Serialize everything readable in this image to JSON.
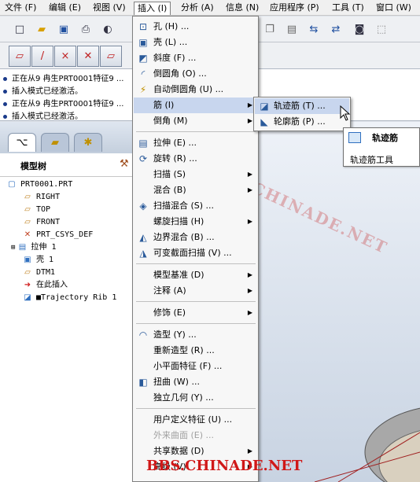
{
  "menubar": {
    "items": [
      "文件 (F)",
      "编辑 (E)",
      "视图 (V)",
      "插入 (I)",
      "分析 (A)",
      "信息 (N)",
      "应用程序 (P)",
      "工具 (T)",
      "窗口 (W)"
    ]
  },
  "messages": [
    "正在从9 冉生PRT0001特征9 ...",
    "插入模式已经激活。",
    "正在从9 冉生PRT0001特征9 ...",
    "插入模式已经激活。"
  ],
  "model_tree": {
    "title": "模型树",
    "items": [
      {
        "label": "PRT0001.PRT",
        "icon": "part-icon"
      },
      {
        "label": "RIGHT",
        "icon": "datum-plane-icon"
      },
      {
        "label": "TOP",
        "icon": "datum-plane-icon"
      },
      {
        "label": "FRONT",
        "icon": "datum-plane-icon"
      },
      {
        "label": "PRT_CSYS_DEF",
        "icon": "csys-icon"
      },
      {
        "label": "拉伸 1",
        "icon": "extrude-icon"
      },
      {
        "label": "壳 1",
        "icon": "shell-icon"
      },
      {
        "label": "DTM1",
        "icon": "datum-plane-icon"
      },
      {
        "label": "在此插入",
        "icon": "insert-here-arrow-icon"
      },
      {
        "label": "■Trajectory Rib 1",
        "icon": "trajectory-rib-icon"
      }
    ]
  },
  "insert_menu": {
    "items": [
      {
        "label": "孔 (H) ...",
        "icon": "hole-icon"
      },
      {
        "label": "壳 (L) ...",
        "icon": "shell-icon"
      },
      {
        "label": "斜度 (F) ...",
        "icon": "draft-icon"
      },
      {
        "label": "倒圆角 (O) ...",
        "icon": "round-icon"
      },
      {
        "label": "自动倒圆角 (U) ...",
        "icon": "auto-round-icon"
      },
      {
        "label": "筋 (I)",
        "icon": "",
        "submenu": true
      },
      {
        "label": "倒角 (M)",
        "icon": "",
        "submenu": true
      },
      {
        "label": "拉伸 (E) ...",
        "icon": "extrude-icon"
      },
      {
        "label": "旋转 (R) ...",
        "icon": "revolve-icon"
      },
      {
        "label": "扫描 (S)",
        "icon": "",
        "submenu": true
      },
      {
        "label": "混合 (B)",
        "icon": "",
        "submenu": true
      },
      {
        "label": "扫描混合 (S) ...",
        "icon": "swept-blend-icon"
      },
      {
        "label": "螺旋扫描 (H)",
        "icon": "",
        "submenu": true
      },
      {
        "label": "边界混合 (B) ...",
        "icon": "boundary-blend-icon"
      },
      {
        "label": "可变截面扫描 (V) ...",
        "icon": "variable-sweep-icon"
      },
      {
        "label": "模型基准 (D)",
        "icon": "",
        "submenu": true
      },
      {
        "label": "注释 (A)",
        "icon": "",
        "submenu": true
      },
      {
        "label": "修饰 (E)",
        "icon": "",
        "submenu": true
      },
      {
        "label": "造型 (Y) ...",
        "icon": "style-icon"
      },
      {
        "label": "重新造型 (R) ...",
        "icon": ""
      },
      {
        "label": "小平面特征 (F) ...",
        "icon": ""
      },
      {
        "label": "扭曲 (W) ...",
        "icon": "warp-icon"
      },
      {
        "label": "独立几何 (Y) ...",
        "icon": ""
      },
      {
        "label": "用户定义特征 (U) ...",
        "icon": ""
      },
      {
        "label": "外来曲面 (E) ...",
        "icon": ""
      },
      {
        "label": "共享数据 (D)",
        "icon": "",
        "submenu": true
      },
      {
        "label": "高级 (V)",
        "icon": "",
        "submenu": true
      }
    ]
  },
  "rib_submenu": {
    "items": [
      {
        "label": "轨迹筋 (T) ...",
        "icon": "trajectory-rib-icon"
      },
      {
        "label": "轮廓筋 (P) ...",
        "icon": "profile-rib-icon"
      }
    ]
  },
  "tooltip": {
    "title": "轨迹筋",
    "description": "轨迹筋工具"
  },
  "watermarks": {
    "diagonal": "BBS.CHINADE.NET",
    "bottom": "BBS.CHINADE.NET"
  },
  "colors": {
    "highlight": "#c8d6ee",
    "watermark": "#d01818"
  }
}
